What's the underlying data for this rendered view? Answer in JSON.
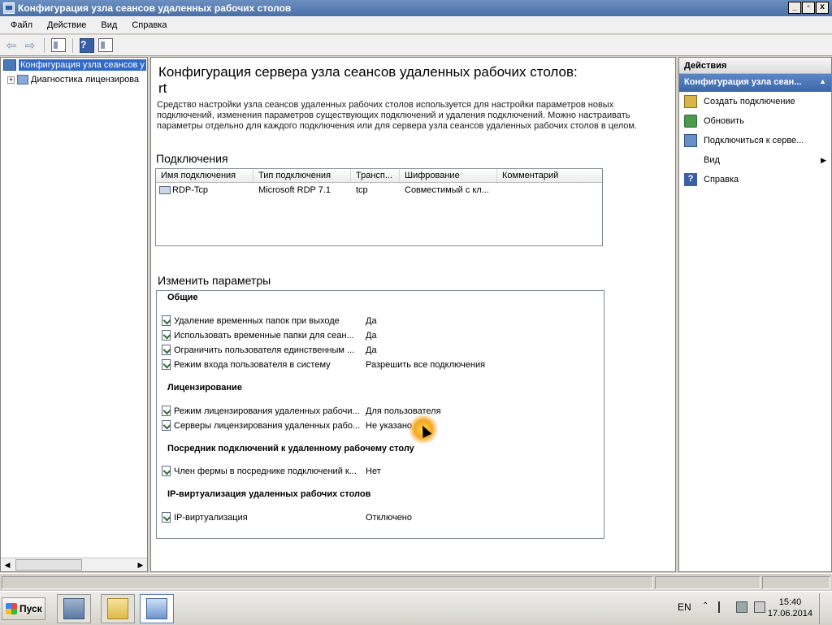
{
  "window": {
    "title": "Конфигурация узла сеансов удаленных рабочих столов",
    "buttons": {
      "minimize": "_",
      "maximize": "▫",
      "close": "x"
    }
  },
  "menu": [
    "Файл",
    "Действие",
    "Вид",
    "Справка"
  ],
  "toolbar": {
    "icons": [
      "back-arrow-icon",
      "forward-arrow-icon",
      "show-hide-tree-icon",
      "help-icon",
      "properties-icon"
    ],
    "help_glyph": "?"
  },
  "tree": {
    "root_label": "Конфигурация узла сеансов у",
    "child_label": "Диагностика лицензирова",
    "expander": "+"
  },
  "main": {
    "title_line1": "Конфигурация сервера узла сеансов удаленных рабочих столов:",
    "title_line2": "rt",
    "description": "Средство настройки узла сеансов удаленных рабочих столов используется для настройки параметров новых подключений, изменения параметров существующих подключений и удаления подключений. Можно настраивать параметры отдельно для каждого подключения или для сервера узла сеансов удаленных рабочих столов в целом.",
    "connections_heading": "Подключения",
    "connections_columns": [
      "Имя подключения",
      "Тип подключения",
      "Трансп...",
      "Шифрование",
      "Комментарий"
    ],
    "connections_rows": [
      [
        "RDP-Tcp",
        "Microsoft RDP 7.1",
        "tcp",
        "Совместимый с кл...",
        ""
      ]
    ],
    "settings_heading": "Изменить параметры",
    "groups": [
      {
        "title": "Общие",
        "items": [
          {
            "name": "Удаление временных папок при выходе",
            "value": "Да"
          },
          {
            "name": "Использовать временные папки для сеан...",
            "value": "Да"
          },
          {
            "name": "Ограничить пользователя единственным ...",
            "value": "Да"
          },
          {
            "name": "Режим входа пользователя в систему",
            "value": "Разрешить все подключения"
          }
        ]
      },
      {
        "title": "Лицензирование",
        "items": [
          {
            "name": "Режим лицензирования удаленных рабочи...",
            "value": "Для пользователя"
          },
          {
            "name": "Серверы лицензирования удаленных рабо...",
            "value": "Не указано"
          }
        ]
      },
      {
        "title": "Посредник подключений к удаленному рабочему столу",
        "items": [
          {
            "name": "Член фермы в посреднике подключений к...",
            "value": "Нет"
          }
        ]
      },
      {
        "title": "IP-виртуализация удаленных рабочих столов",
        "items": [
          {
            "name": "IP-виртуализация",
            "value": "Отключено"
          }
        ]
      }
    ]
  },
  "actions": {
    "header": "Действия",
    "section": "Конфигурация узла сеан...",
    "items": [
      {
        "label": "Создать подключение",
        "icon": "create-connection-icon"
      },
      {
        "label": "Обновить",
        "icon": "refresh-icon"
      },
      {
        "label": "Подключиться к серве...",
        "icon": "connect-server-icon"
      },
      {
        "label": "Вид",
        "icon": "",
        "submenu": true
      },
      {
        "label": "Справка",
        "icon": "help-icon"
      }
    ]
  },
  "taskbar": {
    "start_label": "Пуск",
    "language": "EN",
    "time": "15:40",
    "date": "17.06.2014"
  }
}
